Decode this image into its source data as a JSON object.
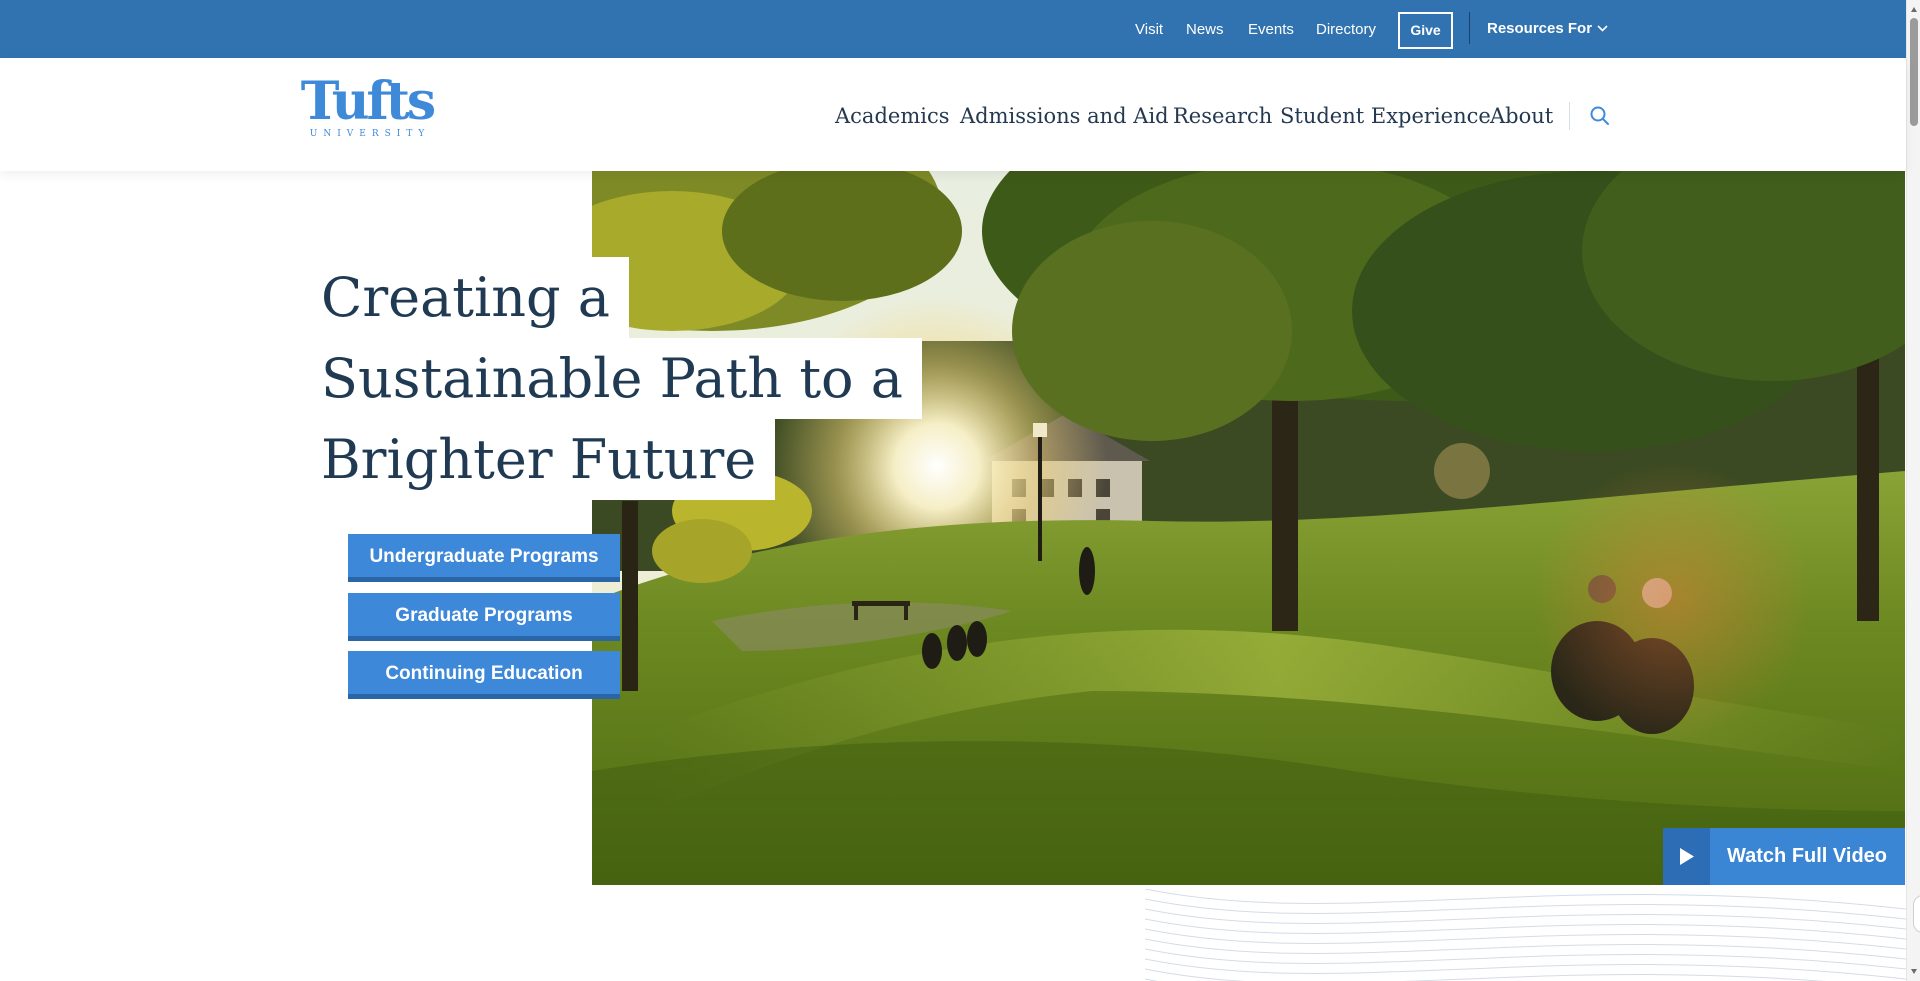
{
  "utility_nav": {
    "links": [
      "Visit",
      "News",
      "Events",
      "Directory"
    ],
    "give_label": "Give",
    "resources_label": "Resources For"
  },
  "header": {
    "logo": {
      "wordmark": "Tufts",
      "subtitle": "UNIVERSITY"
    },
    "nav": [
      "Academics",
      "Admissions and Aid",
      "Research",
      "Student Experience",
      "About"
    ]
  },
  "hero": {
    "title_lines": [
      "Creating a",
      "Sustainable Path to a",
      "Brighter Future"
    ],
    "buttons": [
      "Undergraduate Programs",
      "Graduate Programs",
      "Continuing Education"
    ],
    "watch_label": "Watch Full Video"
  },
  "colors": {
    "utility_bar": "#3172b0",
    "brand_blue": "#3f8ad8",
    "button_blue": "#3d88d9",
    "heading_text": "#1f3a52"
  },
  "icons": [
    "chevron-down-icon",
    "search-icon",
    "play-icon"
  ]
}
